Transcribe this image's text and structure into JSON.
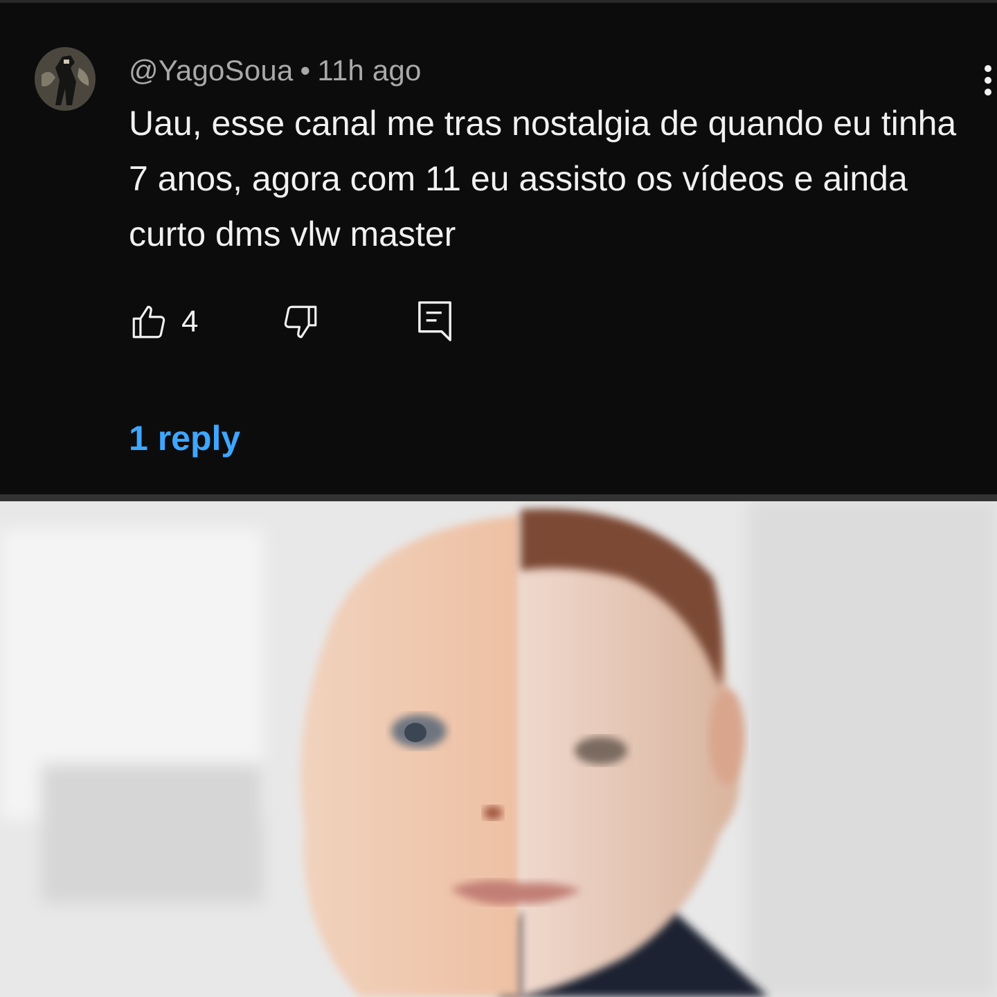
{
  "comment": {
    "username": "@YagoSoua",
    "separator": "•",
    "timestamp": "11h ago",
    "text": "Uau, esse canal me tras nostalgia de quando eu tinha 7 anos, agora com 11 eu assisto os vídeos e ainda curto dms vlw master",
    "like_count": "4",
    "replies_label": "1 reply"
  },
  "icons": {
    "like": "thumbs-up-icon",
    "dislike": "thumbs-down-icon",
    "reply": "reply-comment-icon",
    "more": "more-vertical-icon"
  },
  "colors": {
    "background": "#0c0c0d",
    "text_primary": "#f1f1f1",
    "text_secondary": "#a9a9a9",
    "link": "#3ea6ff"
  }
}
